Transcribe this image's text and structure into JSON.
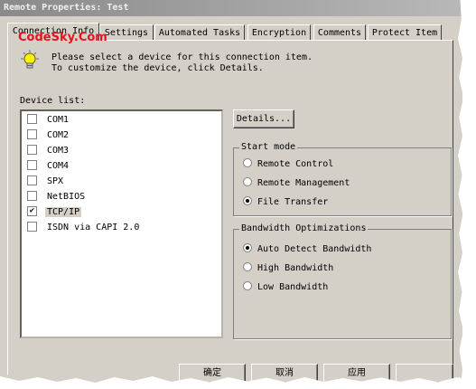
{
  "window": {
    "title": "Remote Properties: Test"
  },
  "watermark": "CodeSky.Com",
  "tabs": [
    {
      "label": "Connection Info",
      "active": true
    },
    {
      "label": "Settings",
      "active": false
    },
    {
      "label": "Automated Tasks",
      "active": false
    },
    {
      "label": "Encryption",
      "active": false
    },
    {
      "label": "Comments",
      "active": false
    },
    {
      "label": "Protect Item",
      "active": false
    }
  ],
  "info": {
    "line1": "Please select a device for this connection item.",
    "line2": "To customize the device, click Details."
  },
  "device_list": {
    "label": "Device list:",
    "items": [
      {
        "label": "COM1",
        "checked": false
      },
      {
        "label": "COM2",
        "checked": false
      },
      {
        "label": "COM3",
        "checked": false
      },
      {
        "label": "COM4",
        "checked": false
      },
      {
        "label": "SPX",
        "checked": false
      },
      {
        "label": "NetBIOS",
        "checked": false
      },
      {
        "label": "TCP/IP",
        "checked": true
      },
      {
        "label": "ISDN via CAPI 2.0",
        "checked": false
      }
    ]
  },
  "details_button": "Details...",
  "start_mode": {
    "title": "Start mode",
    "options": [
      {
        "label": "Remote Control",
        "selected": false
      },
      {
        "label": "Remote Management",
        "selected": false
      },
      {
        "label": "File Transfer",
        "selected": true
      }
    ]
  },
  "bandwidth": {
    "title": "Bandwidth Optimizations",
    "options": [
      {
        "label": "Auto Detect Bandwidth",
        "selected": true
      },
      {
        "label": "High Bandwidth",
        "selected": false
      },
      {
        "label": "Low Bandwidth",
        "selected": false
      }
    ]
  },
  "footer": {
    "ok_label": "确定",
    "cancel_label": "取消",
    "apply_label": "应用"
  }
}
